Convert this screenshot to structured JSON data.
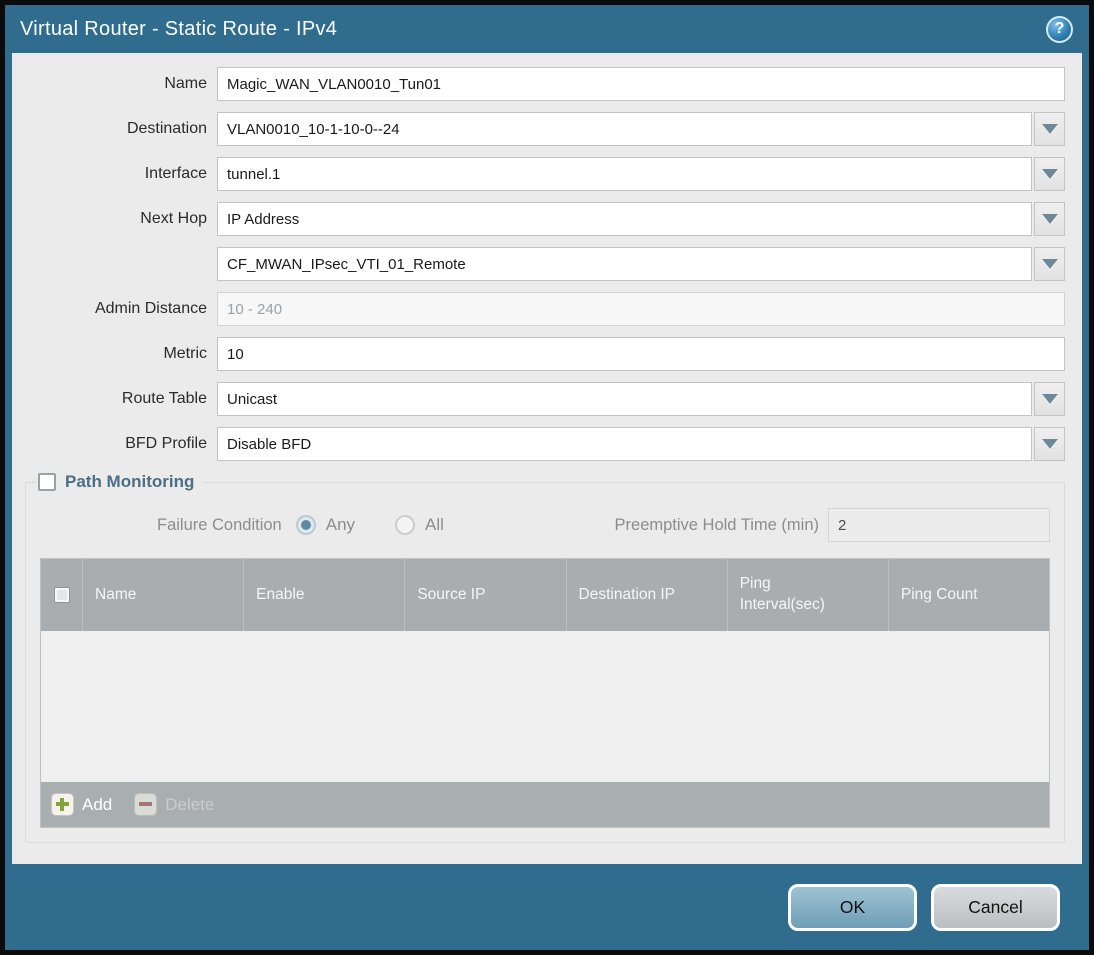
{
  "dialog": {
    "title": "Virtual Router - Static Route - IPv4",
    "help_icon": "?"
  },
  "form": {
    "name": {
      "label": "Name",
      "value": "Magic_WAN_VLAN0010_Tun01"
    },
    "destination": {
      "label": "Destination",
      "value": "VLAN0010_10-1-10-0--24"
    },
    "interface": {
      "label": "Interface",
      "value": "tunnel.1"
    },
    "next_hop": {
      "label": "Next Hop",
      "value": "IP Address"
    },
    "next_hop_address": {
      "value": "CF_MWAN_IPsec_VTI_01_Remote"
    },
    "admin_distance": {
      "label": "Admin Distance",
      "placeholder": "10 - 240",
      "value": ""
    },
    "metric": {
      "label": "Metric",
      "value": "10"
    },
    "route_table": {
      "label": "Route Table",
      "value": "Unicast"
    },
    "bfd_profile": {
      "label": "BFD Profile",
      "value": "Disable BFD"
    }
  },
  "path_monitoring": {
    "title": "Path Monitoring",
    "checked": false,
    "failure_condition_label": "Failure Condition",
    "options": [
      {
        "label": "Any",
        "selected": true
      },
      {
        "label": "All",
        "selected": false
      }
    ],
    "preemptive_label": "Preemptive Hold Time (min)",
    "preemptive_value": "2",
    "table": {
      "columns": [
        "Name",
        "Enable",
        "Source IP",
        "Destination IP",
        "Ping Interval(sec)",
        "Ping Count"
      ],
      "rows": []
    },
    "add_label": "Add",
    "delete_label": "Delete"
  },
  "footer": {
    "ok_label": "OK",
    "cancel_label": "Cancel"
  },
  "colors": {
    "titlebar": "#2f6c8d",
    "table_header": "#a9adb0",
    "ok_button": "#7ea8bf",
    "accent_radio": "#5d8aa5"
  }
}
